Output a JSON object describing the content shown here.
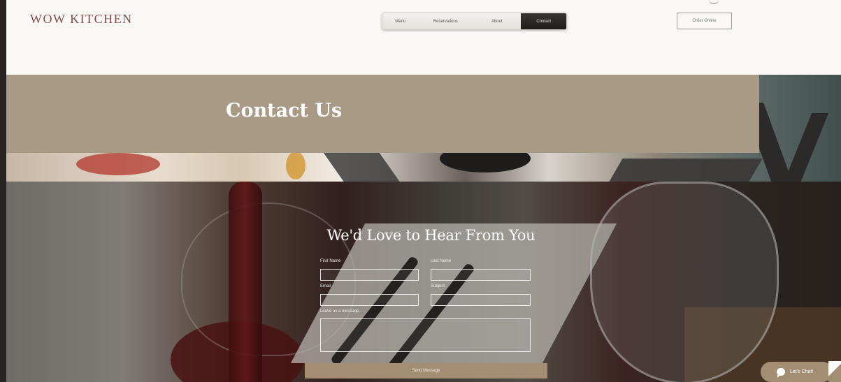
{
  "header": {
    "logo": "WOW KITCHEN",
    "nav": [
      {
        "label": "Menu"
      },
      {
        "label": "Reservations"
      },
      {
        "label": "About"
      },
      {
        "label": "Contact",
        "active": true
      }
    ],
    "order_button": "Order Online"
  },
  "banner": {
    "title": "Contact Us"
  },
  "form": {
    "title": "We'd Love to Hear From You",
    "first_name_label": "First Name",
    "last_name_label": "Last Name",
    "email_label": "Email",
    "subject_label": "Subject",
    "message_label": "Leave us a message...",
    "first_name_value": "",
    "last_name_value": "",
    "email_value": "",
    "subject_value": "",
    "message_value": "",
    "submit_label": "Send Message"
  },
  "chat": {
    "label": "Let's Chat!",
    "icon": "chat-bubble-icon"
  },
  "colors": {
    "logo": "#8a4c4c",
    "banner_panel": "#a99a85",
    "accent_button": "#a38e74",
    "header_bg": "#faf8f5"
  }
}
